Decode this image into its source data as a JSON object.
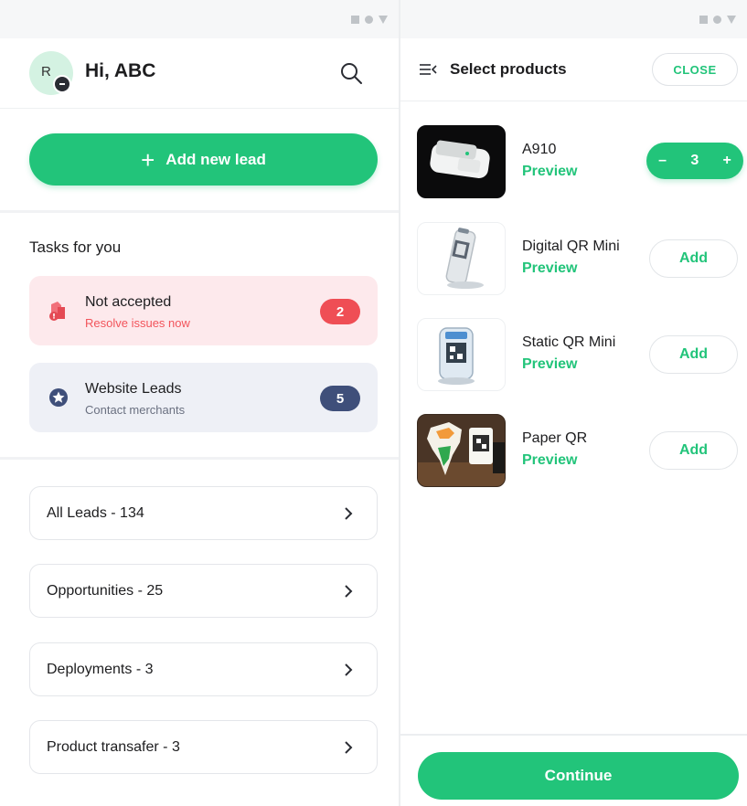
{
  "left": {
    "greeting": "Hi, ABC",
    "avatar_initial": "R",
    "add_lead_label": "Add new lead",
    "tasks_title": "Tasks for you",
    "tasks": [
      {
        "title": "Not accepted",
        "subtitle": "Resolve issues now",
        "count": "2",
        "icon": "warning-document-icon",
        "color": "#ef4e55"
      },
      {
        "title": "Website Leads",
        "subtitle": "Contact merchants",
        "count": "5",
        "icon": "star-badge-icon",
        "color": "#3f4f7a"
      }
    ],
    "nav_items": [
      {
        "label": "All Leads  -  134"
      },
      {
        "label": "Opportunities  -  25"
      },
      {
        "label": "Deployments - 3"
      },
      {
        "label": "Product transafer - 3"
      }
    ]
  },
  "right": {
    "title": "Select products",
    "close_label": "CLOSE",
    "products": [
      {
        "name": "A910",
        "preview": "Preview",
        "quantity": "3",
        "minus": "–",
        "plus": "+"
      },
      {
        "name": "Digital QR Mini",
        "preview": "Preview",
        "action": "Add"
      },
      {
        "name": "Static QR Mini",
        "preview": "Preview",
        "action": "Add"
      },
      {
        "name": "Paper QR",
        "preview": "Preview",
        "action": "Add"
      }
    ],
    "continue_label": "Continue"
  },
  "colors": {
    "accent": "#22c47a",
    "danger": "#ef4e55",
    "info": "#3f4f7a"
  }
}
